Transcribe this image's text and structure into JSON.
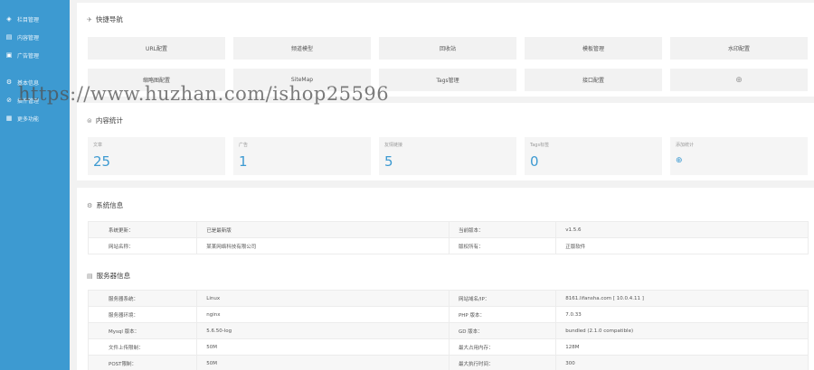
{
  "sidebar": {
    "items": [
      {
        "label": "栏目管理",
        "icon": "layers-icon"
      },
      {
        "label": "内容管理",
        "icon": "document-icon"
      },
      {
        "label": "广告管理",
        "icon": "ad-icon"
      },
      {
        "label": "基本信息",
        "icon": "gear-icon"
      },
      {
        "label": "插件管理",
        "icon": "plugin-icon"
      },
      {
        "label": "更多功能",
        "icon": "grid-icon"
      }
    ]
  },
  "quicknav": {
    "title": "快捷导航",
    "buttons": [
      "URL配置",
      "频道模型",
      "回收站",
      "模板管理",
      "水印配置",
      "缩略图配置",
      "SiteMap",
      "Tags管理",
      "接口配置",
      "⊕"
    ]
  },
  "stats": {
    "title": "内容统计",
    "items": [
      {
        "label": "文章",
        "value": "25"
      },
      {
        "label": "广告",
        "value": "1"
      },
      {
        "label": "友情链接",
        "value": "5"
      },
      {
        "label": "Tags标签",
        "value": "0"
      },
      {
        "label": "添加统计",
        "value": "⊕"
      }
    ]
  },
  "sysinfo": {
    "title": "系统信息",
    "rows": [
      [
        "系统更新：",
        "已是最新版",
        "当前版本：",
        "v1.5.6"
      ],
      [
        "网站名称：",
        "某某网络科技有限公司",
        "版权所有：",
        "正版软件"
      ]
    ]
  },
  "serverinfo": {
    "title": "服务器信息",
    "rows": [
      [
        "服务器系统：",
        "Linux",
        "网站域名/IP：",
        "8161.lifansha.com [ 10.0.4.11 ]"
      ],
      [
        "服务器环境：",
        "nginx",
        "PHP 版本：",
        "7.0.33"
      ],
      [
        "Mysql 版本：",
        "5.6.50-log",
        "GD 版本：",
        "bundled (2.1.0 compatible)"
      ],
      [
        "文件上传限制：",
        "50M",
        "最大占用内存：",
        "128M"
      ],
      [
        "POST限制：",
        "50M",
        "最大执行时间：",
        "300"
      ]
    ]
  },
  "watermark": "https://www.huzhan.com/ishop25596",
  "colors": {
    "sidebar": "#3d9ad1",
    "accent": "#3d9ad1",
    "background": "#f2f2f2"
  }
}
